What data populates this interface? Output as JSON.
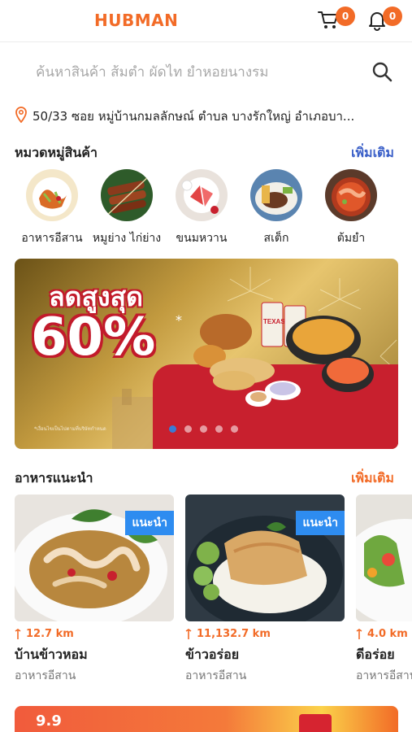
{
  "header": {
    "brand": "HUBMAN",
    "cart_count": "0",
    "notification_count": "0"
  },
  "search": {
    "placeholder": "ค้นหาสินค้า ส้มตำ ผัดไท ยำหอยนางรม"
  },
  "address": {
    "text": "50/33 ซอย หมู่บ้านกมลลักษณ์ ตำบล บางรักใหญ่ อำเภอบา..."
  },
  "categories": {
    "title": "หมวดหมู่สินค้า",
    "more": "เพิ่มเติม",
    "items": [
      {
        "label": "อาหารอีสาน"
      },
      {
        "label": "หมูย่าง ไก่ย่าง"
      },
      {
        "label": "ขนมหวาน"
      },
      {
        "label": "สเต็ก"
      },
      {
        "label": "ต้มยำ"
      }
    ]
  },
  "banner": {
    "headline": "ลดสูงสุด",
    "percent": "60%",
    "star": "*",
    "fine_print": "*เงื่อนไขเป็นไปตามที่บริษัทกำหนด",
    "brand_cup": "TEXAS",
    "slide_count": 5,
    "active_slide": 0
  },
  "recommended": {
    "title": "อาหารแนะนำ",
    "more": "เพิ่มเติม",
    "items": [
      {
        "tag": "แนะนำ",
        "distance": "12.7 km",
        "name": "บ้านข้าวหอม",
        "category": "อาหารอีสาน"
      },
      {
        "tag": "แนะนำ",
        "distance": "11,132.7 km",
        "name": "ข้าวอร่อย",
        "category": "อาหารอีสาน"
      },
      {
        "tag": "",
        "distance": "4.0 km",
        "name": "ดีอร่อย",
        "category": "อาหารอีสาน"
      }
    ]
  },
  "bottom_banner": {
    "text": "9.9"
  },
  "colors": {
    "accent": "#f26b27",
    "link_blue": "#3a5fc8",
    "tag_blue": "#2e8cf0",
    "banner_red": "#c21a2b"
  }
}
